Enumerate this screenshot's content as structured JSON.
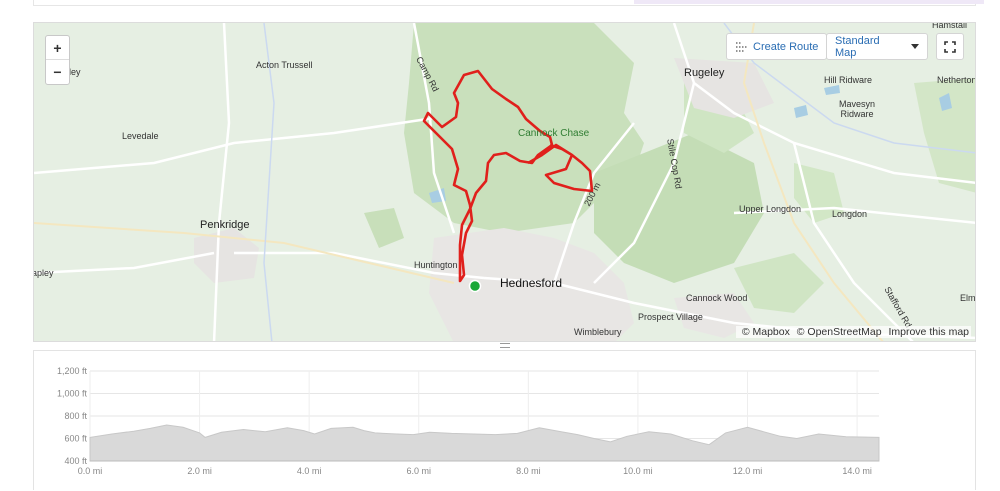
{
  "map": {
    "zoom_in": "+",
    "zoom_out": "−",
    "create_route": "Create Route",
    "map_style": "Standard Map",
    "attribution": {
      "mapbox": "© Mapbox",
      "osm": "© OpenStreetMap",
      "improve": "Improve this map"
    },
    "labels": {
      "hamstall": "Hamstall",
      "dley": "dley",
      "acton_trussell": "Acton Trussell",
      "camp_rd": "Camp Rd",
      "rugeley": "Rugeley",
      "hill_ridware": "Hill Ridware",
      "netherton": "Netherton",
      "mavesyn_ridware": "Mavesyn\nRidware",
      "levedale": "Levedale",
      "cannock_chase": "Cannock Chase",
      "stile_cop_rd": "Stile Cop Rd",
      "contour_200m": "200 m",
      "penkridge": "Penkridge",
      "upper_longdon": "Upper Longdon",
      "longdon": "Longdon",
      "huntington": "Huntington",
      "hednesford": "Hednesford",
      "apley": "apley",
      "stafford_rd": "Stafford Rd",
      "cannock_wood": "Cannock Wood",
      "prospect_village": "Prospect Village",
      "wimblebury": "Wimblebury",
      "elmh": "Elmh"
    },
    "icons": {
      "create_route": "route-dotted-icon",
      "dropdown": "caret-down-icon",
      "fullscreen": "fullscreen-icon",
      "start": "start-marker-icon"
    },
    "colors": {
      "route": "#e0201c",
      "start": "#1aa838",
      "accent": "#2a6db3"
    }
  },
  "chart_data": {
    "type": "area",
    "xlabel": "",
    "ylabel": "",
    "x_ticks": [
      "0.0 mi",
      "2.0 mi",
      "4.0 mi",
      "6.0 mi",
      "8.0 mi",
      "10.0 mi",
      "12.0 mi",
      "14.0 mi"
    ],
    "y_ticks": [
      "400 ft",
      "600 ft",
      "800 ft",
      "1,000 ft",
      "1,200 ft"
    ],
    "xlim": [
      0,
      14.4
    ],
    "ylim": [
      400,
      1200
    ],
    "grid": true,
    "series": [
      {
        "x": [
          0,
          0.4,
          0.8,
          1.1,
          1.4,
          1.7,
          2.0,
          2.1,
          2.4,
          2.8,
          3.2,
          3.6,
          3.9,
          4.1,
          4.4,
          4.8,
          5.0,
          5.2,
          5.6,
          5.9,
          6.2,
          6.6,
          7.0,
          7.4,
          7.8,
          8.2,
          8.6,
          8.9,
          9.2,
          9.5,
          9.8,
          10.2,
          10.6,
          11.0,
          11.3,
          11.6,
          12.0,
          12.3,
          12.6,
          12.9,
          13.3,
          13.8,
          14.4
        ],
        "y": [
          610,
          640,
          665,
          690,
          720,
          700,
          650,
          610,
          655,
          680,
          660,
          695,
          670,
          640,
          690,
          700,
          670,
          650,
          640,
          635,
          655,
          645,
          640,
          635,
          645,
          695,
          660,
          635,
          600,
          570,
          620,
          660,
          640,
          580,
          545,
          650,
          700,
          660,
          620,
          600,
          640,
          615,
          610
        ]
      }
    ]
  }
}
